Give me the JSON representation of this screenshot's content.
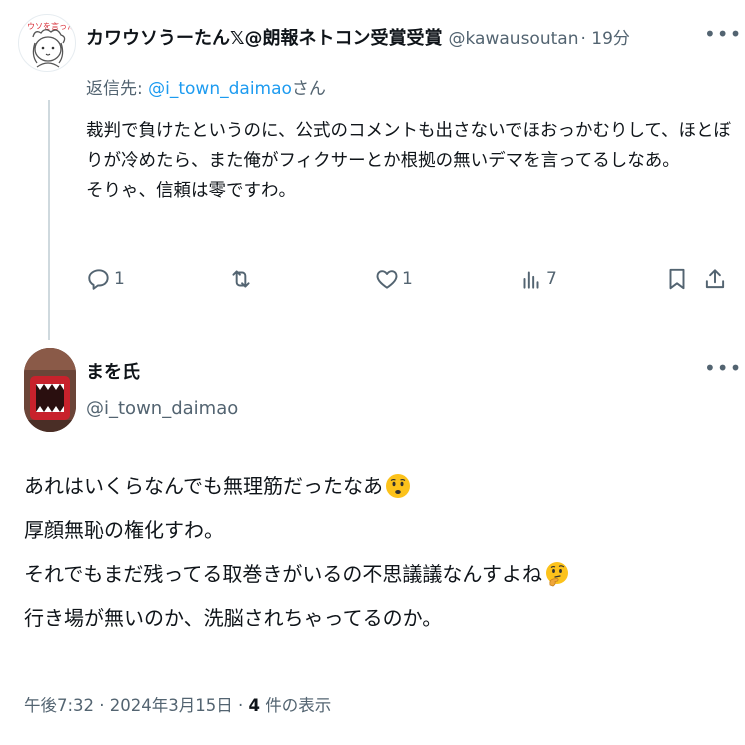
{
  "reply_tweet": {
    "author_name": "カワウソうーたん𝕏@朗報ネトコン受賞受賞",
    "author_handle": "@kawausoutan",
    "time_ago": "· 19分",
    "replying_to_prefix": "返信先: ",
    "replying_to_mention": "@i_town_daimao",
    "replying_to_suffix": "さん",
    "text_lines": [
      "裁判で負けたというのに、公式のコメントも出さないでほおっかむりして、ほとぼ",
      "りが冷めたら、また俺がフィクサーとか根拠の無いデマを言ってるしなあ。",
      "そりゃ、信頼は零ですわ。"
    ],
    "reply_count": "1",
    "retweet_count": "",
    "like_count": "1",
    "view_count": "7",
    "more_icon": "more-horizontal-icon",
    "avatar_text": "ウソを言った"
  },
  "main_tweet": {
    "author_name": "まを氏",
    "author_handle": "@i_town_daimao",
    "text_lines": [
      "あれはいくらなんでも無理筋だったなあ",
      "厚顔無恥の権化すわ。",
      "それでもまだ残ってる取巻きがいるの不思議議なんすよね",
      "行き場が無いのか、洗脳されちゃってるのか。"
    ],
    "line1_emoji": "worried-face-emoji",
    "line3_emoji": "thinking-face-emoji",
    "timestamp": "午後7:32 · 2024年3月15日 · ",
    "views_count": "4",
    "views_label": " 件の表示"
  },
  "colors": {
    "text": "#0f1419",
    "secondary": "#536471",
    "link": "#1d9bf0",
    "thread_line": "#cfd9de"
  }
}
